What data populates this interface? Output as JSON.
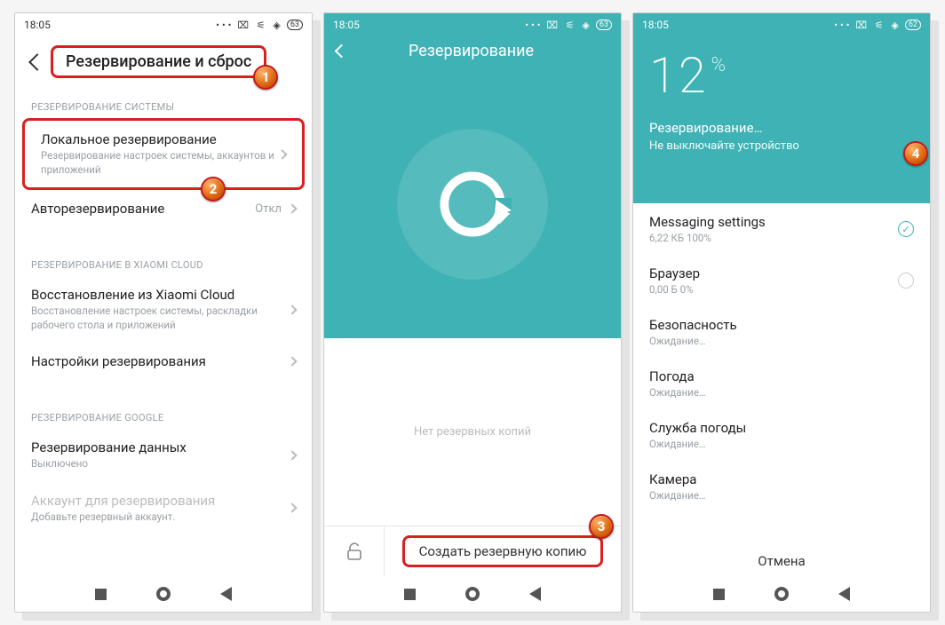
{
  "status": {
    "time": "18:05",
    "dots": "•••",
    "battery1": "63",
    "battery3": "62"
  },
  "screen1": {
    "title": "Резервирование и сброс",
    "section_system": "РЕЗЕРВИРОВАНИЕ СИСТЕМЫ",
    "local": {
      "title": "Локальное резервирование",
      "sub": "Резервирование настроек системы, аккаунтов и приложений"
    },
    "auto": {
      "title": "Авторезервирование",
      "value": "Откл"
    },
    "section_cloud": "РЕЗЕРВИРОВАНИЕ В XIAOMI CLOUD",
    "restore_cloud": {
      "title": "Восстановление из Xiaomi Cloud",
      "sub": "Восстановление настроек системы, раскладки рабочего стола и приложений"
    },
    "backup_settings": "Настройки резервирования",
    "section_google": "РЕЗЕРВИРОВАНИЕ GOOGLE",
    "data_backup": {
      "title": "Резервирование данных",
      "sub": "Выключено"
    },
    "account": {
      "title": "Аккаунт для резервирования",
      "sub": "Добавьте резервный аккаунт."
    }
  },
  "screen2": {
    "title": "Резервирование",
    "empty": "Нет резервных копий",
    "create": "Создать резервную копию"
  },
  "screen3": {
    "percent": "12",
    "line1": "Резервирование…",
    "line2": "Не выключайте устройство",
    "items": [
      {
        "name": "Messaging settings",
        "status": "6,22 КБ 100%",
        "state": "done"
      },
      {
        "name": "Браузер",
        "status": "0,00 Б 0%",
        "state": "progress"
      },
      {
        "name": "Безопасность",
        "status": "Ожидание…",
        "state": "wait"
      },
      {
        "name": "Погода",
        "status": "Ожидание…",
        "state": "wait"
      },
      {
        "name": "Служба погоды",
        "status": "Ожидание…",
        "state": "wait"
      },
      {
        "name": "Камера",
        "status": "Ожидание…",
        "state": "wait"
      }
    ],
    "cancel": "Отмена"
  },
  "badges": {
    "b1": "1",
    "b2": "2",
    "b3": "3",
    "b4": "4"
  }
}
